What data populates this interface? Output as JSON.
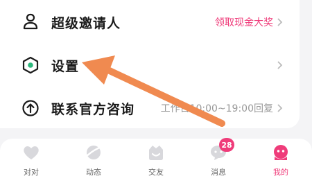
{
  "menu": {
    "items": [
      {
        "label": "超级邀请人",
        "extra": "领取现金大奖",
        "icon": "invite-user-icon"
      },
      {
        "label": "设置",
        "extra": "",
        "icon": "settings-icon"
      },
      {
        "label": "联系官方咨询",
        "extra": "工作日10:00~19:00回复",
        "icon": "upload-circle-icon"
      }
    ]
  },
  "tabbar": {
    "tabs": [
      {
        "label": "对对",
        "icon": "heart-icon"
      },
      {
        "label": "动态",
        "icon": "planet-icon"
      },
      {
        "label": "交友",
        "icon": "smile-icon"
      },
      {
        "label": "消息",
        "icon": "chat-bubble-icon",
        "badge": "28"
      },
      {
        "label": "我的",
        "icon": "profile-icon",
        "active": true
      }
    ]
  },
  "colors": {
    "accent": "#ef3c7a",
    "arrow": "#f08a50",
    "text": "#1a1a1a",
    "muted": "#999999"
  }
}
